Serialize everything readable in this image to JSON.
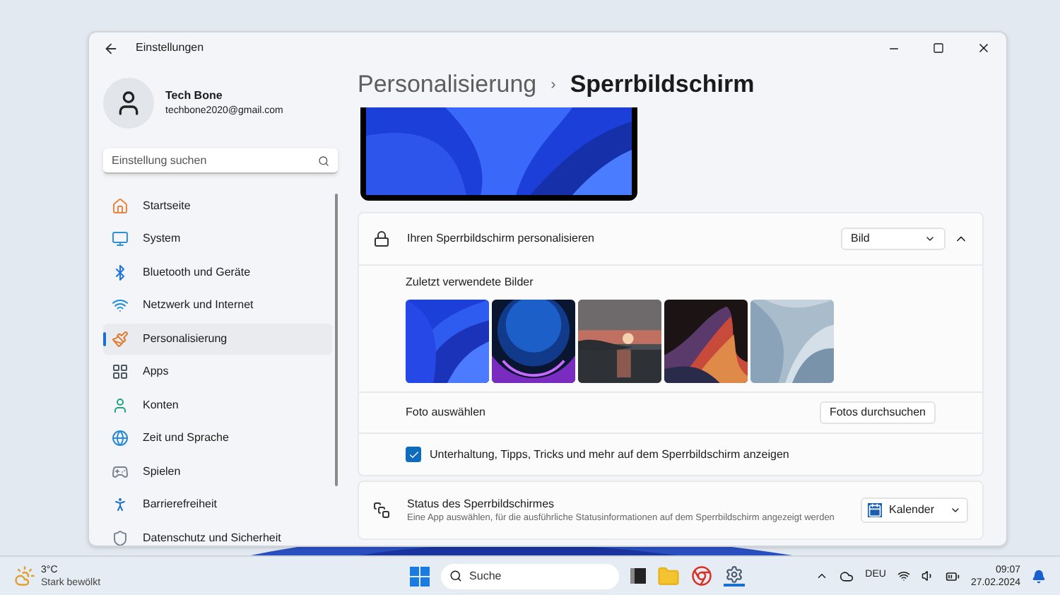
{
  "window": {
    "title": "Einstellungen"
  },
  "account": {
    "name": "Tech Bone",
    "email": "techbone2020@gmail.com"
  },
  "search": {
    "placeholder": "Einstellung suchen"
  },
  "sidebar": {
    "items": [
      {
        "label": "Startseite",
        "selected": false
      },
      {
        "label": "System",
        "selected": false
      },
      {
        "label": "Bluetooth und Geräte",
        "selected": false
      },
      {
        "label": "Netzwerk und Internet",
        "selected": false
      },
      {
        "label": "Personalisierung",
        "selected": true
      },
      {
        "label": "Apps",
        "selected": false
      },
      {
        "label": "Konten",
        "selected": false
      },
      {
        "label": "Zeit und Sprache",
        "selected": false
      },
      {
        "label": "Spielen",
        "selected": false
      },
      {
        "label": "Barrierefreiheit",
        "selected": false
      },
      {
        "label": "Datenschutz und Sicherheit",
        "selected": false
      }
    ]
  },
  "breadcrumb": {
    "parent": "Personalisierung",
    "separator": "›",
    "current": "Sperrbildschirm"
  },
  "personalize": {
    "label": "Ihren Sperrbildschirm personalisieren",
    "dropdown": "Bild",
    "expanded": true,
    "recent_label": "Zuletzt verwendete Bilder",
    "choose_label": "Foto auswählen",
    "browse_button": "Fotos durchsuchen",
    "tips": {
      "label": "Unterhaltung, Tipps, Tricks und mehr auf dem Sperrbildschirm anzeigen",
      "checked": true
    }
  },
  "status": {
    "title": "Status des Sperrbildschirmes",
    "description": "Eine App auswählen, für die ausführliche Statusinformationen auf dem Sperrbildschirm angezeigt werden",
    "dropdown": "Kalender"
  },
  "taskbar": {
    "weather_temp": "3°C",
    "weather_text": "Stark bewölkt",
    "search": "Suche",
    "language": "DEU",
    "time": "09:07",
    "date": "27.02.2024"
  }
}
